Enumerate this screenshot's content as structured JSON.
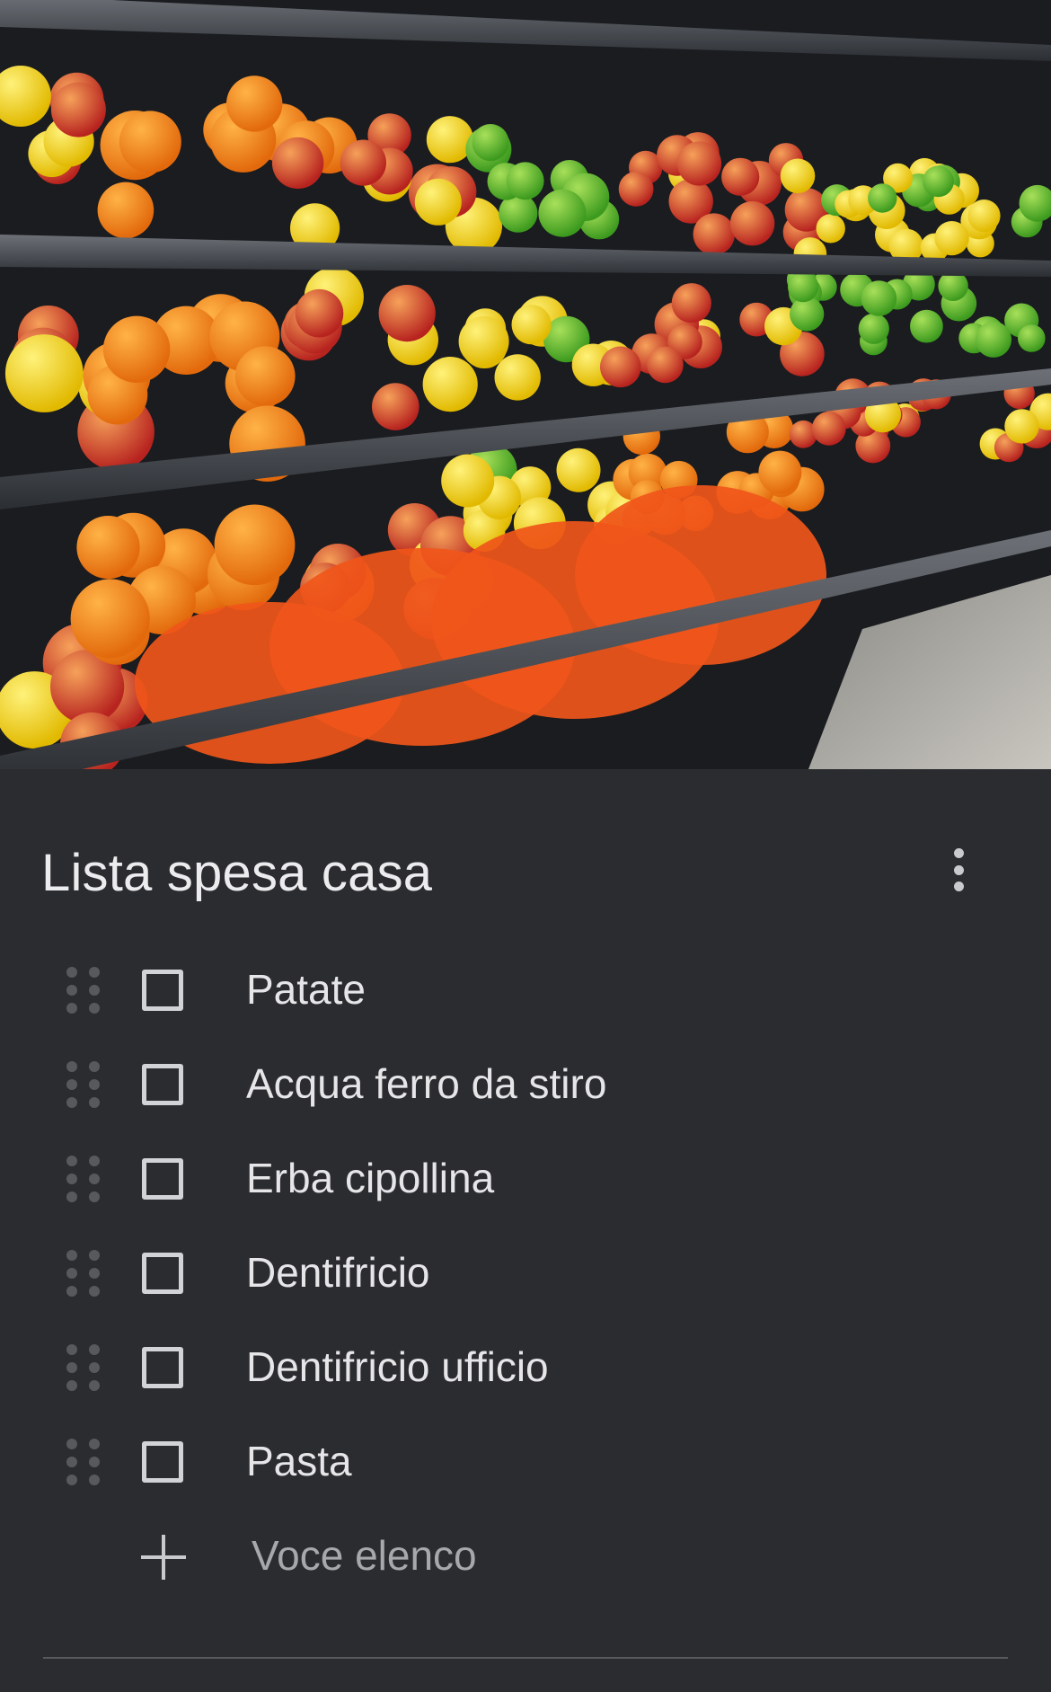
{
  "header_image": {
    "alt": ""
  },
  "note": {
    "title": "Lista spesa casa",
    "more_icon": "more-vert-icon",
    "items": [
      {
        "label": "Patate",
        "checked": false
      },
      {
        "label": "Acqua ferro da stiro",
        "checked": false
      },
      {
        "label": "Erba cipollina",
        "checked": false
      },
      {
        "label": "Dentifricio",
        "checked": false
      },
      {
        "label": "Dentifricio ufficio",
        "checked": false
      },
      {
        "label": "Pasta",
        "checked": false
      }
    ],
    "add_item": {
      "icon": "plus-icon",
      "placeholder": "Voce elenco"
    }
  },
  "colors": {
    "background": "#2b2c30",
    "text": "#e6e6e8",
    "muted_text": "#a7a8ab",
    "drag_handle": "#58595d",
    "checkbox_border": "#d2d3d6"
  }
}
